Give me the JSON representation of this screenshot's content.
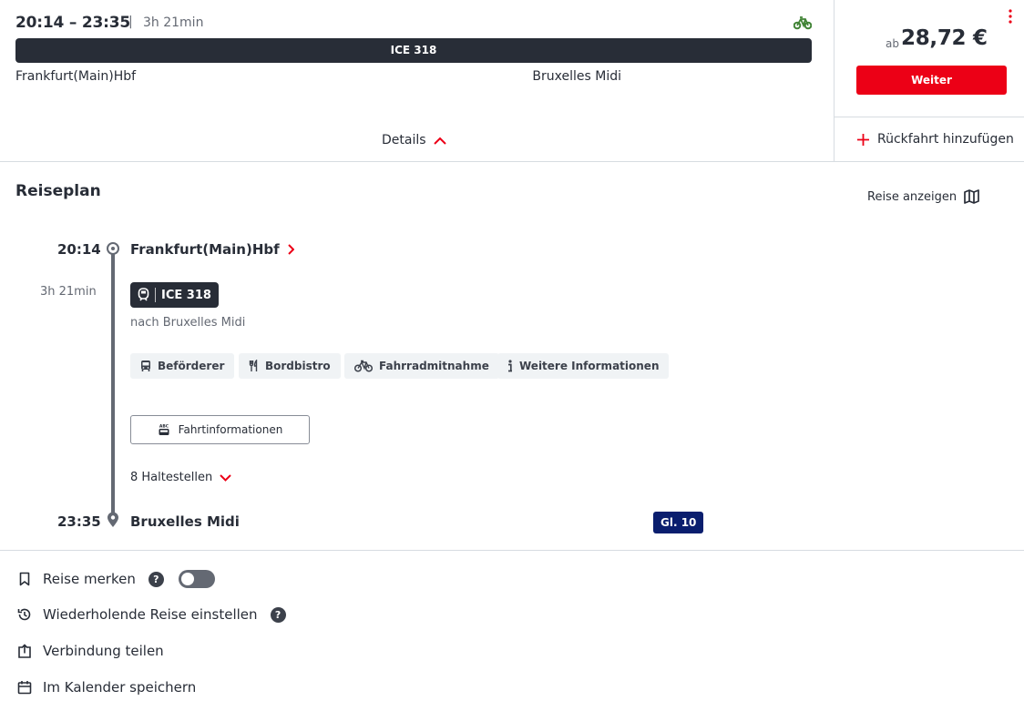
{
  "connection": {
    "times": "20:14 – 23:35",
    "separator": "|",
    "duration": "3h 21min",
    "train_bar_label": "ICE 318",
    "from": "Frankfurt(Main)Hbf",
    "to": "Bruxelles Midi",
    "details_label": "Details"
  },
  "price": {
    "prefix": "ab",
    "value": "28,72 €",
    "continue_label": "Weiter",
    "return_label": "Rückfahrt hinzufügen"
  },
  "reiseplan": {
    "title": "Reiseplan",
    "show_trip_label": "Reise anzeigen",
    "departure_time": "20:14",
    "departure_station": "Frankfurt(Main)Hbf",
    "leg_duration": "3h 21min",
    "train_label": "ICE 318",
    "direction": "nach Bruxelles Midi",
    "chips": [
      {
        "label": "Beförderer",
        "icon": "bus-icon"
      },
      {
        "label": "Bordbistro",
        "icon": "cutlery-icon"
      },
      {
        "label": "Fahrradmitnahme",
        "icon": "bicycle-icon"
      },
      {
        "label": "Weitere Informationen",
        "icon": "info-icon"
      }
    ],
    "trip_info_label": "Fahrtinformationen",
    "trip_info_icon_text": "ABC",
    "stops_label": "8 Haltestellen",
    "arrival_time": "23:35",
    "arrival_station": "Bruxelles Midi",
    "platform": "Gl. 10"
  },
  "actions": {
    "save_trip": "Reise merken",
    "recurring": "Wiederholende Reise einstellen",
    "share": "Verbindung teilen",
    "calendar": "Im Kalender speichern",
    "help_glyph": "?"
  },
  "colors": {
    "accent_red": "#ec0016",
    "dark": "#282d37",
    "platform_blue": "#0a1e6e",
    "bike_green": "#408335"
  }
}
